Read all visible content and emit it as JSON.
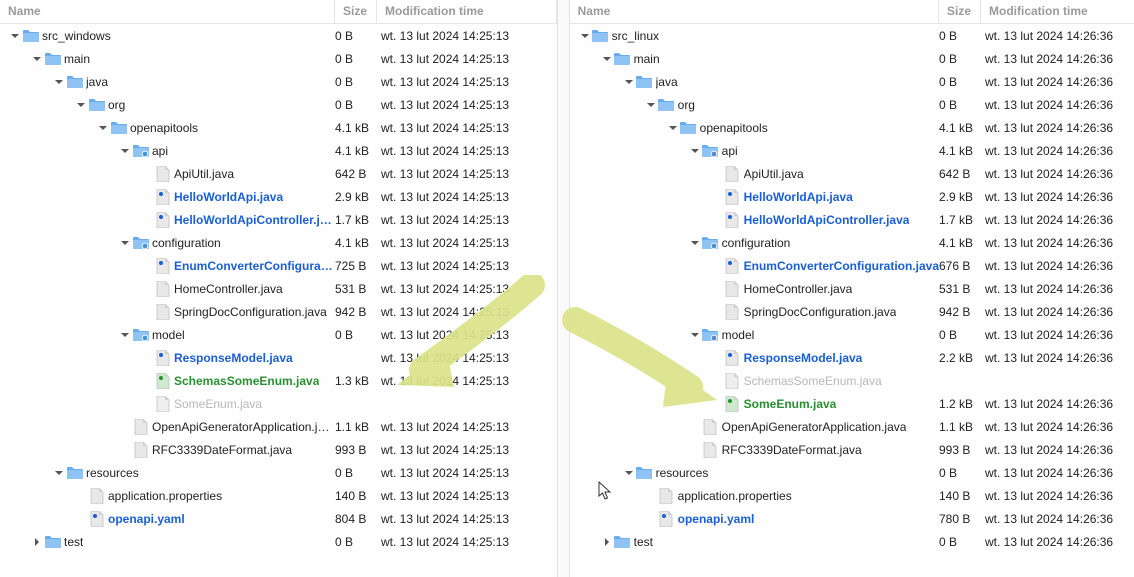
{
  "headers": {
    "name": "Name",
    "size": "Size",
    "time": "Modification time"
  },
  "left": {
    "time": "wt. 13 lut 2024 14:25:13"
  },
  "right": {
    "time": "wt. 13 lut 2024 14:26:36"
  },
  "leftRows": [
    {
      "d": 0,
      "type": "dir",
      "tw": "down",
      "name": "src_windows",
      "size": "0 B"
    },
    {
      "d": 1,
      "type": "dir",
      "tw": "down",
      "name": "main",
      "size": "0 B"
    },
    {
      "d": 2,
      "type": "dir",
      "tw": "down",
      "name": "java",
      "size": "0 B"
    },
    {
      "d": 3,
      "type": "dir",
      "tw": "down",
      "name": "org",
      "size": "0 B"
    },
    {
      "d": 4,
      "type": "dir",
      "tw": "down",
      "name": "openapitools",
      "size": "4.1 kB"
    },
    {
      "d": 5,
      "type": "pkg",
      "tw": "down",
      "name": "api",
      "size": "4.1 kB"
    },
    {
      "d": 6,
      "type": "file",
      "tw": "",
      "name": "ApiUtil.java",
      "size": "642 B"
    },
    {
      "d": 6,
      "type": "file",
      "tw": "",
      "name": "HelloWorldApi.java",
      "size": "2.9 kB",
      "style": "diff"
    },
    {
      "d": 6,
      "type": "file",
      "tw": "",
      "name": "HelloWorldApiController.java",
      "size": "1.7 kB",
      "style": "diff"
    },
    {
      "d": 5,
      "type": "pkg",
      "tw": "down",
      "name": "configuration",
      "size": "4.1 kB"
    },
    {
      "d": 6,
      "type": "file",
      "tw": "",
      "name": "EnumConverterConfiguration.java",
      "size": "725 B",
      "style": "diff"
    },
    {
      "d": 6,
      "type": "file",
      "tw": "",
      "name": "HomeController.java",
      "size": "531 B"
    },
    {
      "d": 6,
      "type": "file",
      "tw": "",
      "name": "SpringDocConfiguration.java",
      "size": "942 B"
    },
    {
      "d": 5,
      "type": "pkg",
      "tw": "down",
      "name": "model",
      "size": "0 B"
    },
    {
      "d": 6,
      "type": "file",
      "tw": "",
      "name": "ResponseModel.java",
      "size": "",
      "style": "diff"
    },
    {
      "d": 6,
      "type": "file",
      "tw": "",
      "name": "SchemasSomeEnum.java",
      "size": "1.3 kB",
      "style": "added"
    },
    {
      "d": 6,
      "type": "file",
      "tw": "",
      "name": "SomeEnum.java",
      "size": "",
      "style": "removed"
    },
    {
      "d": 5,
      "type": "file",
      "tw": "",
      "name": "OpenApiGeneratorApplication.java",
      "size": "1.1 kB"
    },
    {
      "d": 5,
      "type": "file",
      "tw": "",
      "name": "RFC3339DateFormat.java",
      "size": "993 B"
    },
    {
      "d": 2,
      "type": "dir",
      "tw": "down",
      "name": "resources",
      "size": "0 B"
    },
    {
      "d": 3,
      "type": "file",
      "tw": "",
      "name": "application.properties",
      "size": "140 B"
    },
    {
      "d": 3,
      "type": "file",
      "tw": "",
      "name": "openapi.yaml",
      "size": "804 B",
      "style": "diff"
    },
    {
      "d": 1,
      "type": "dir",
      "tw": "right",
      "name": "test",
      "size": "0 B"
    }
  ],
  "rightRows": [
    {
      "d": 0,
      "type": "dir",
      "tw": "down",
      "name": "src_linux",
      "size": "0 B"
    },
    {
      "d": 1,
      "type": "dir",
      "tw": "down",
      "name": "main",
      "size": "0 B"
    },
    {
      "d": 2,
      "type": "dir",
      "tw": "down",
      "name": "java",
      "size": "0 B"
    },
    {
      "d": 3,
      "type": "dir",
      "tw": "down",
      "name": "org",
      "size": "0 B"
    },
    {
      "d": 4,
      "type": "dir",
      "tw": "down",
      "name": "openapitools",
      "size": "4.1 kB"
    },
    {
      "d": 5,
      "type": "pkg",
      "tw": "down",
      "name": "api",
      "size": "4.1 kB"
    },
    {
      "d": 6,
      "type": "file",
      "tw": "",
      "name": "ApiUtil.java",
      "size": "642 B"
    },
    {
      "d": 6,
      "type": "file",
      "tw": "",
      "name": "HelloWorldApi.java",
      "size": "2.9 kB",
      "style": "diff"
    },
    {
      "d": 6,
      "type": "file",
      "tw": "",
      "name": "HelloWorldApiController.java",
      "size": "1.7 kB",
      "style": "diff"
    },
    {
      "d": 5,
      "type": "pkg",
      "tw": "down",
      "name": "configuration",
      "size": "4.1 kB"
    },
    {
      "d": 6,
      "type": "file",
      "tw": "",
      "name": "EnumConverterConfiguration.java",
      "size": "676 B",
      "style": "diff"
    },
    {
      "d": 6,
      "type": "file",
      "tw": "",
      "name": "HomeController.java",
      "size": "531 B"
    },
    {
      "d": 6,
      "type": "file",
      "tw": "",
      "name": "SpringDocConfiguration.java",
      "size": "942 B"
    },
    {
      "d": 5,
      "type": "pkg",
      "tw": "down",
      "name": "model",
      "size": "0 B"
    },
    {
      "d": 6,
      "type": "file",
      "tw": "",
      "name": "ResponseModel.java",
      "size": "2.2 kB",
      "style": "diff"
    },
    {
      "d": 6,
      "type": "file",
      "tw": "",
      "name": "SchemasSomeEnum.java",
      "size": "",
      "style": "removed"
    },
    {
      "d": 6,
      "type": "file",
      "tw": "",
      "name": "SomeEnum.java",
      "size": "1.2 kB",
      "style": "added"
    },
    {
      "d": 5,
      "type": "file",
      "tw": "",
      "name": "OpenApiGeneratorApplication.java",
      "size": "1.1 kB"
    },
    {
      "d": 5,
      "type": "file",
      "tw": "",
      "name": "RFC3339DateFormat.java",
      "size": "993 B"
    },
    {
      "d": 2,
      "type": "dir",
      "tw": "down",
      "name": "resources",
      "size": "0 B"
    },
    {
      "d": 3,
      "type": "file",
      "tw": "",
      "name": "application.properties",
      "size": "140 B"
    },
    {
      "d": 3,
      "type": "file",
      "tw": "",
      "name": "openapi.yaml",
      "size": "780 B",
      "style": "diff"
    },
    {
      "d": 1,
      "type": "dir",
      "tw": "right",
      "name": "test",
      "size": "0 B"
    }
  ]
}
